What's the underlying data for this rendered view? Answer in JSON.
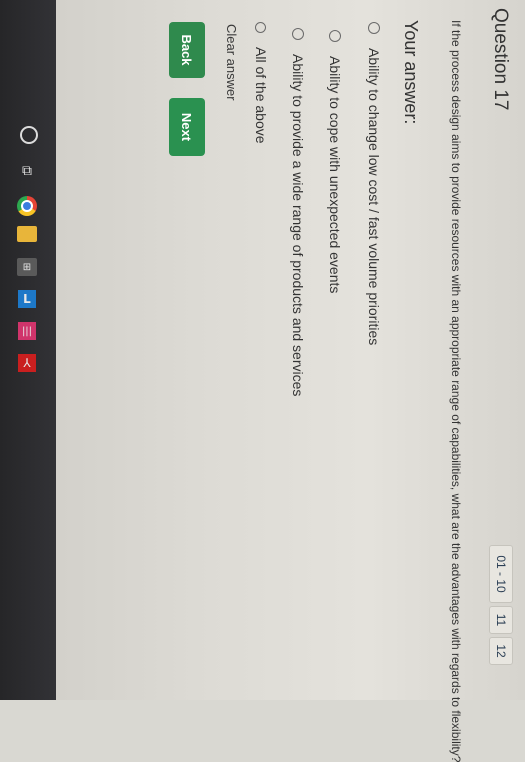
{
  "quiz": {
    "title": "Question 17",
    "question": "If the process design aims to provide resources with an appropriate range of capabilities, what are the advantages with regards to flexibility?",
    "answer_heading": "Your answer:",
    "options": [
      {
        "label": "Ability to change low cost / fast volume priorities"
      },
      {
        "label": "Ability to cope with unexpected events"
      },
      {
        "label": "Ability to provide a wide range of products and services"
      },
      {
        "label": "All of the above"
      }
    ],
    "clear_label": "Clear answer",
    "back_label": "Back",
    "next_label": "Next"
  },
  "pagination": {
    "range_label": "01 - 10",
    "pages": [
      "11",
      "12"
    ]
  },
  "taskbar": {
    "icons": [
      "cortana-icon",
      "task-view-icon",
      "chrome-icon",
      "file-explorer-icon",
      "store-icon",
      "app-l-icon",
      "app-bars-icon",
      "acrobat-icon"
    ]
  },
  "colors": {
    "button": "#2f8a4d",
    "taskbar": "#2b2b2e",
    "page_background": "#dddbd5"
  }
}
